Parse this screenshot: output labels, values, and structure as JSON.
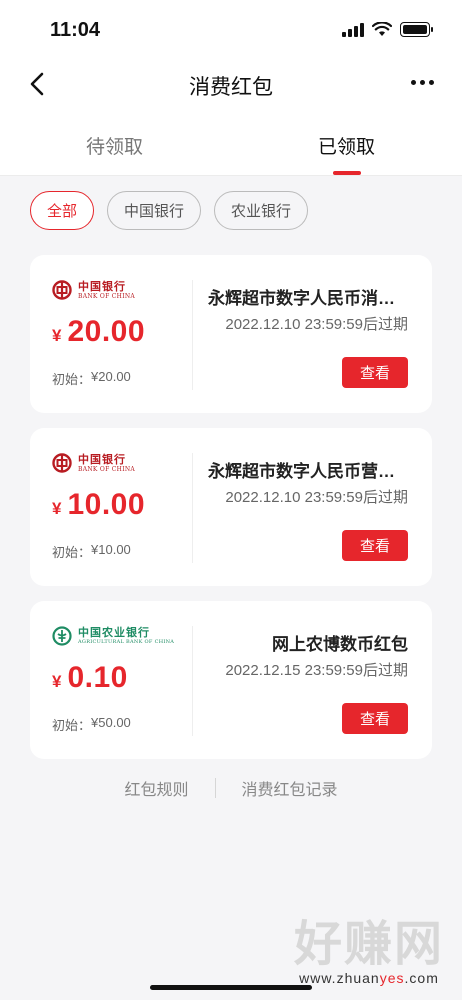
{
  "status_bar": {
    "time": "11:04"
  },
  "nav": {
    "title": "消费红包"
  },
  "tabs": [
    {
      "label": "待领取"
    },
    {
      "label": "已领取"
    }
  ],
  "filters": [
    {
      "label": "全部"
    },
    {
      "label": "中国银行"
    },
    {
      "label": "农业银行"
    }
  ],
  "cards": [
    {
      "bank_cn": "中国银行",
      "bank_en": "BANK OF CHINA",
      "currency": "¥",
      "amount": "20.00",
      "initial_label": "初始：",
      "initial_value": "¥20.00",
      "title": "永辉超市数字人民币消费红包",
      "expiry": "2022.12.10 23:59:59后过期",
      "button": "查看"
    },
    {
      "bank_cn": "中国银行",
      "bank_en": "BANK OF CHINA",
      "currency": "¥",
      "amount": "10.00",
      "initial_label": "初始：",
      "initial_value": "¥10.00",
      "title": "永辉超市数字人民币营销红包",
      "expiry": "2022.12.10 23:59:59后过期",
      "button": "查看"
    },
    {
      "bank_cn": "中国农业银行",
      "bank_en": "AGRICULTURAL BANK OF CHINA",
      "currency": "¥",
      "amount": "0.10",
      "initial_label": "初始：",
      "initial_value": "¥50.00",
      "title": "网上农博数币红包",
      "expiry": "2022.12.15 23:59:59后过期",
      "button": "查看"
    }
  ],
  "footer": {
    "rules": "红包规则",
    "records": "消费红包记录"
  },
  "watermark": {
    "main": "好赚网",
    "sub_prefix": "www.zhuan",
    "sub_highlight": "yes",
    "sub_suffix": ".com"
  },
  "colors": {
    "accent": "#e6262c",
    "boc_red": "#b81c22",
    "abc_green": "#1f8c64"
  }
}
